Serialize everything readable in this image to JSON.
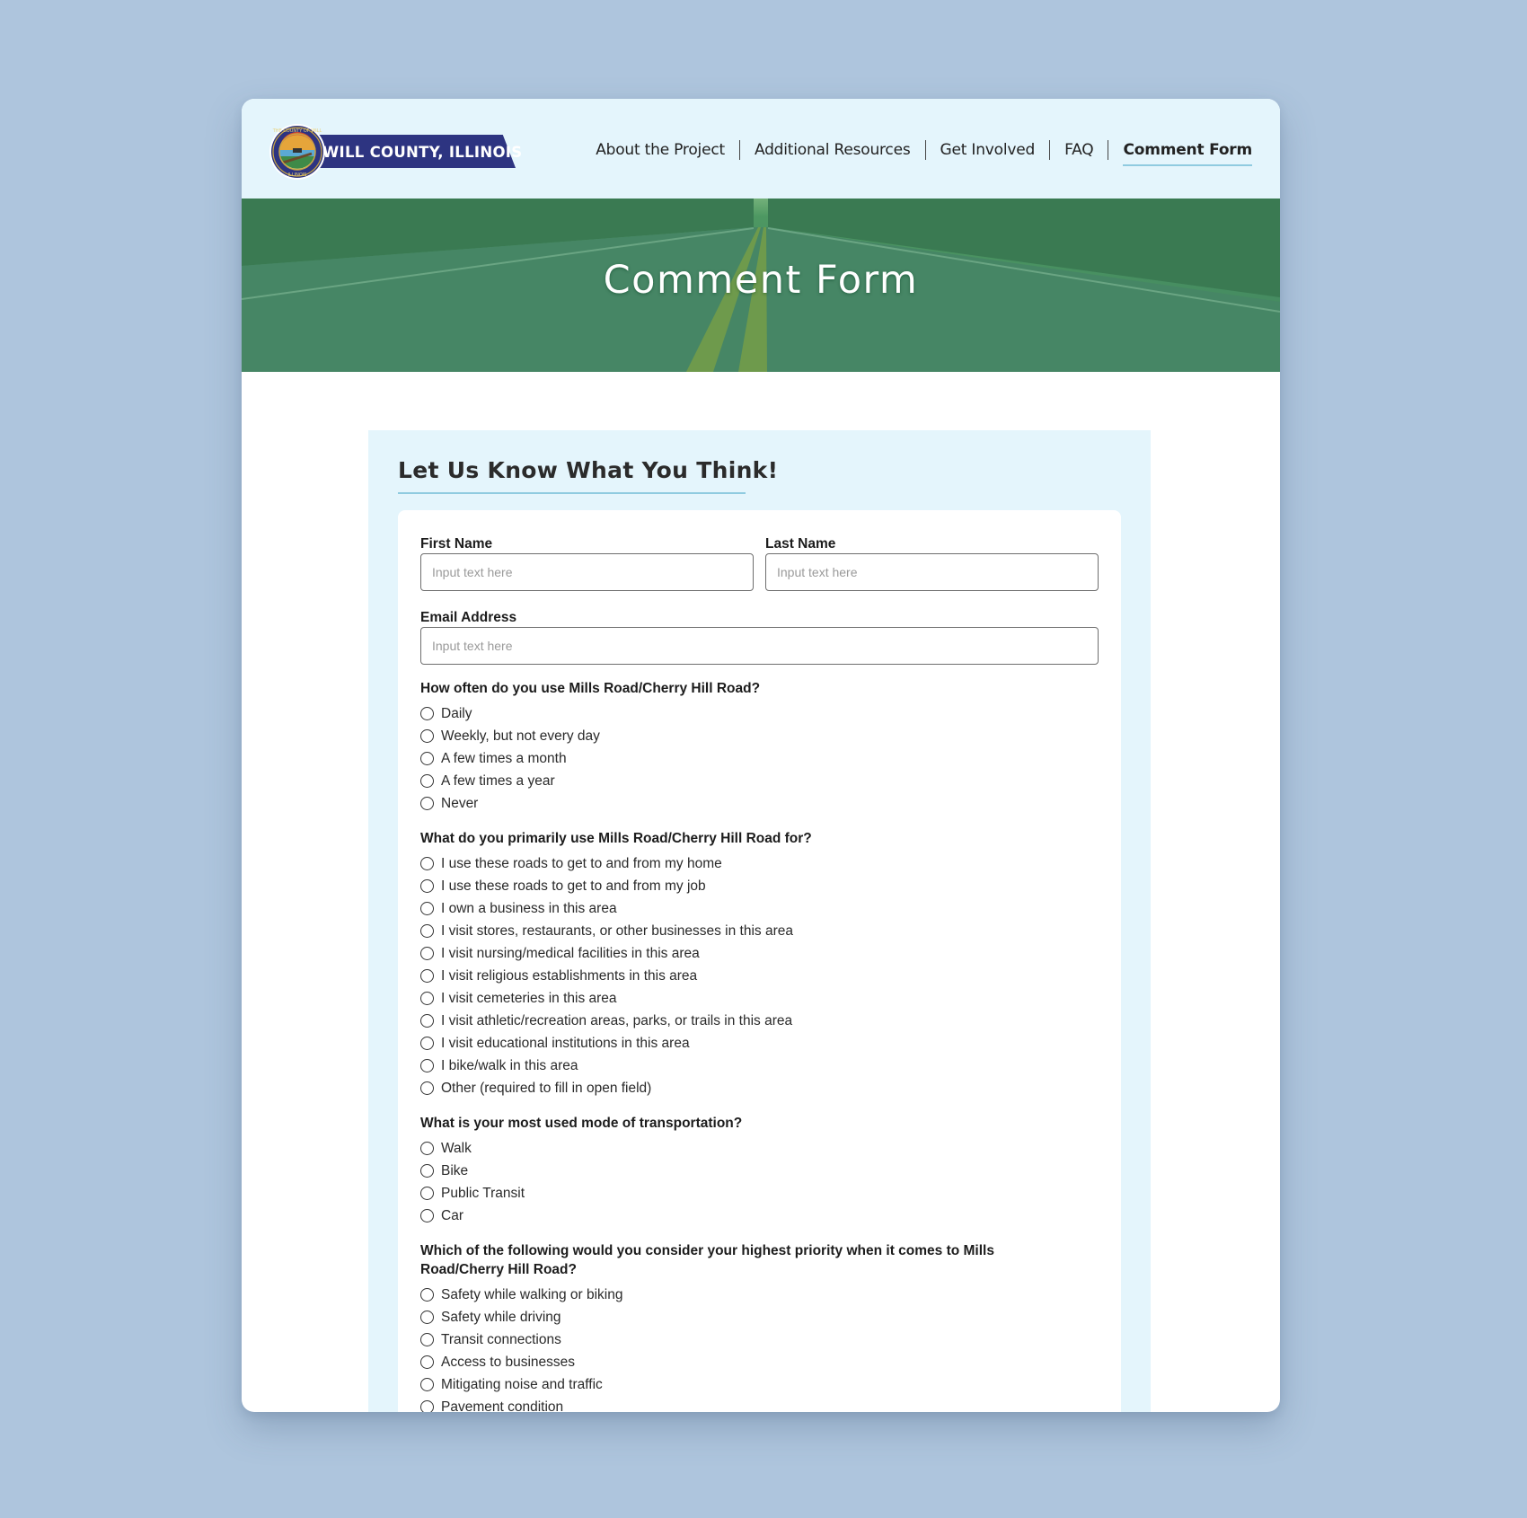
{
  "header": {
    "logo_text": "WILL COUNTY, ILLINOIS",
    "nav": [
      {
        "label": "About the Project",
        "active": false
      },
      {
        "label": "Additional Resources",
        "active": false
      },
      {
        "label": "Get Involved",
        "active": false
      },
      {
        "label": "FAQ",
        "active": false
      },
      {
        "label": "Comment Form",
        "active": true
      }
    ]
  },
  "hero": {
    "title": "Comment Form"
  },
  "form": {
    "heading": "Let Us Know What You Think!",
    "first_name": {
      "label": "First Name",
      "placeholder": "Input text here",
      "value": ""
    },
    "last_name": {
      "label": "Last Name",
      "placeholder": "Input text here",
      "value": ""
    },
    "email": {
      "label": "Email Address",
      "placeholder": "Input text here",
      "value": ""
    },
    "questions": [
      {
        "text": "How often do you use Mills Road/Cherry Hill Road?",
        "options": [
          "Daily",
          "Weekly, but not every day",
          "A few times a month",
          "A few times a year",
          "Never"
        ]
      },
      {
        "text": "What do you primarily use Mills Road/Cherry Hill Road for?",
        "options": [
          "I use these roads to get to and from my home",
          "I use these roads to get to and from my job",
          "I own a business in this area",
          "I visit stores, restaurants, or other businesses in this area",
          "I visit nursing/medical facilities in this area",
          "I visit religious establishments in this area",
          "I visit cemeteries in this area",
          "I visit athletic/recreation areas, parks, or trails in this area",
          "I visit educational institutions in this area",
          "I bike/walk in this area",
          "Other (required to fill in open field)"
        ]
      },
      {
        "text": "What is your most used mode of transportation?",
        "options": [
          "Walk",
          "Bike",
          "Public Transit",
          "Car"
        ]
      },
      {
        "text": "Which of the following would you consider your highest priority when it comes to Mills Road/Cherry Hill Road?",
        "options": [
          "Safety while walking or biking",
          "Safety while driving",
          "Transit connections",
          "Access to businesses",
          "Mitigating noise and traffic",
          "Pavement condition"
        ]
      }
    ]
  },
  "colors": {
    "page_background": "#aec5dd",
    "header_background": "#e4f5fc",
    "hero_green": "#3f8260",
    "logo_navy": "#2d3481",
    "accent_underline": "#8fcbe0"
  }
}
